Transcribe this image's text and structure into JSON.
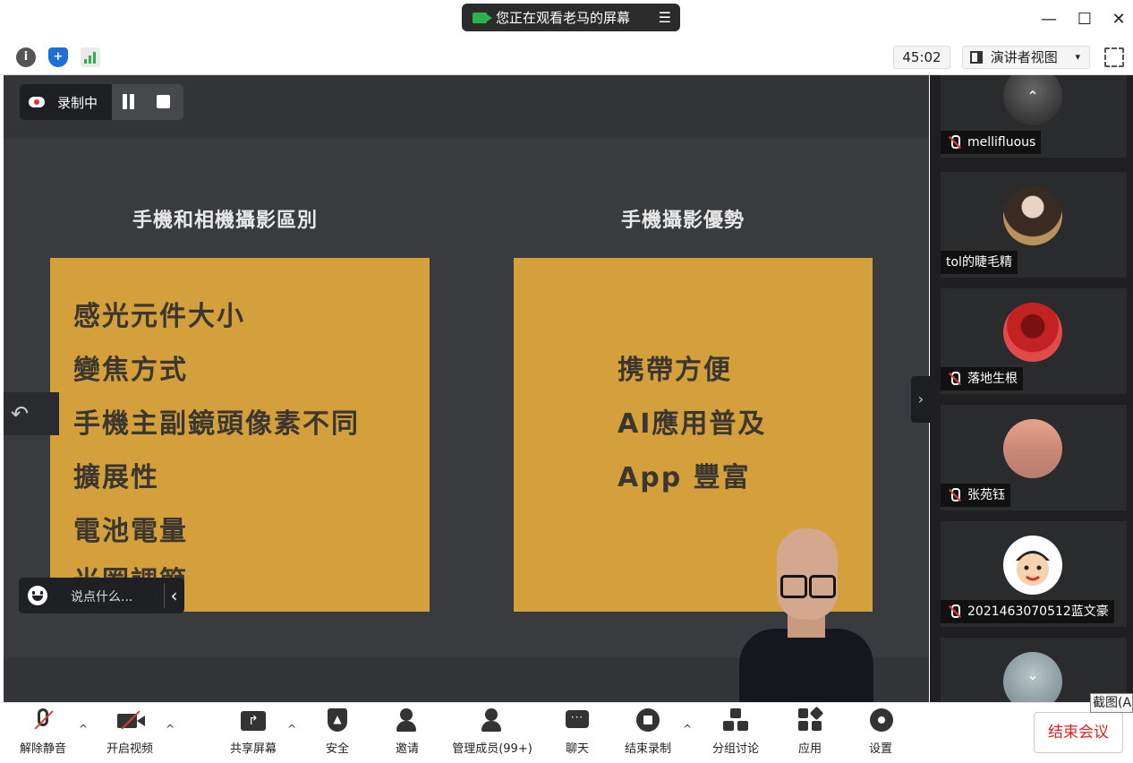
{
  "titlebar": {
    "sharing_banner": "您正在观看老马的屏幕",
    "sharing_menu_icon": "list-icon",
    "minimize": "—",
    "maximize": "☐",
    "close": "✕"
  },
  "toolbar": {
    "info_icon": "i",
    "security_icon": "+",
    "timer": "45:02",
    "view_mode": "演讲者视图",
    "view_mode_caret": "▾"
  },
  "recording": {
    "label": "录制中"
  },
  "slide": {
    "left_heading": "手機和相機攝影區別",
    "right_heading": "手機攝影優勢",
    "left_items": [
      "感光元件大小",
      "變焦方式",
      "手機主副鏡頭像素不同",
      "擴展性",
      "電池電量",
      "光圈調節"
    ],
    "right_items": [
      "携帶方便",
      "AI應用普及",
      "App 豐富"
    ],
    "card_color": "#d4a03b"
  },
  "annotation": {
    "undo_icon": "↶"
  },
  "chat": {
    "placeholder": "说点什么...",
    "collapse": "‹"
  },
  "sidebar_toggle": "›",
  "gallery": {
    "scroll_up": "⌃",
    "scroll_down": "⌄",
    "participants": [
      {
        "name": "mellifluous",
        "muted": true
      },
      {
        "name": "tol的睫毛精",
        "muted": false
      },
      {
        "name": "落地生根",
        "muted": true
      },
      {
        "name": "张苑钰",
        "muted": true
      },
      {
        "name": "2021463070512蓝文豪",
        "muted": true
      }
    ]
  },
  "bottom_toolbar": {
    "unmute": "解除静音",
    "start_video": "开启视频",
    "share_screen": "共享屏幕",
    "security": "安全",
    "invite": "邀请",
    "manage_participants": "管理成员(99+)",
    "chat": "聊天",
    "end_recording": "结束录制",
    "breakout_rooms": "分组讨论",
    "apps": "应用",
    "settings": "设置",
    "end_meeting": "结束会议",
    "caret": "^"
  },
  "tooltip": {
    "screenshot": "截图(A"
  }
}
